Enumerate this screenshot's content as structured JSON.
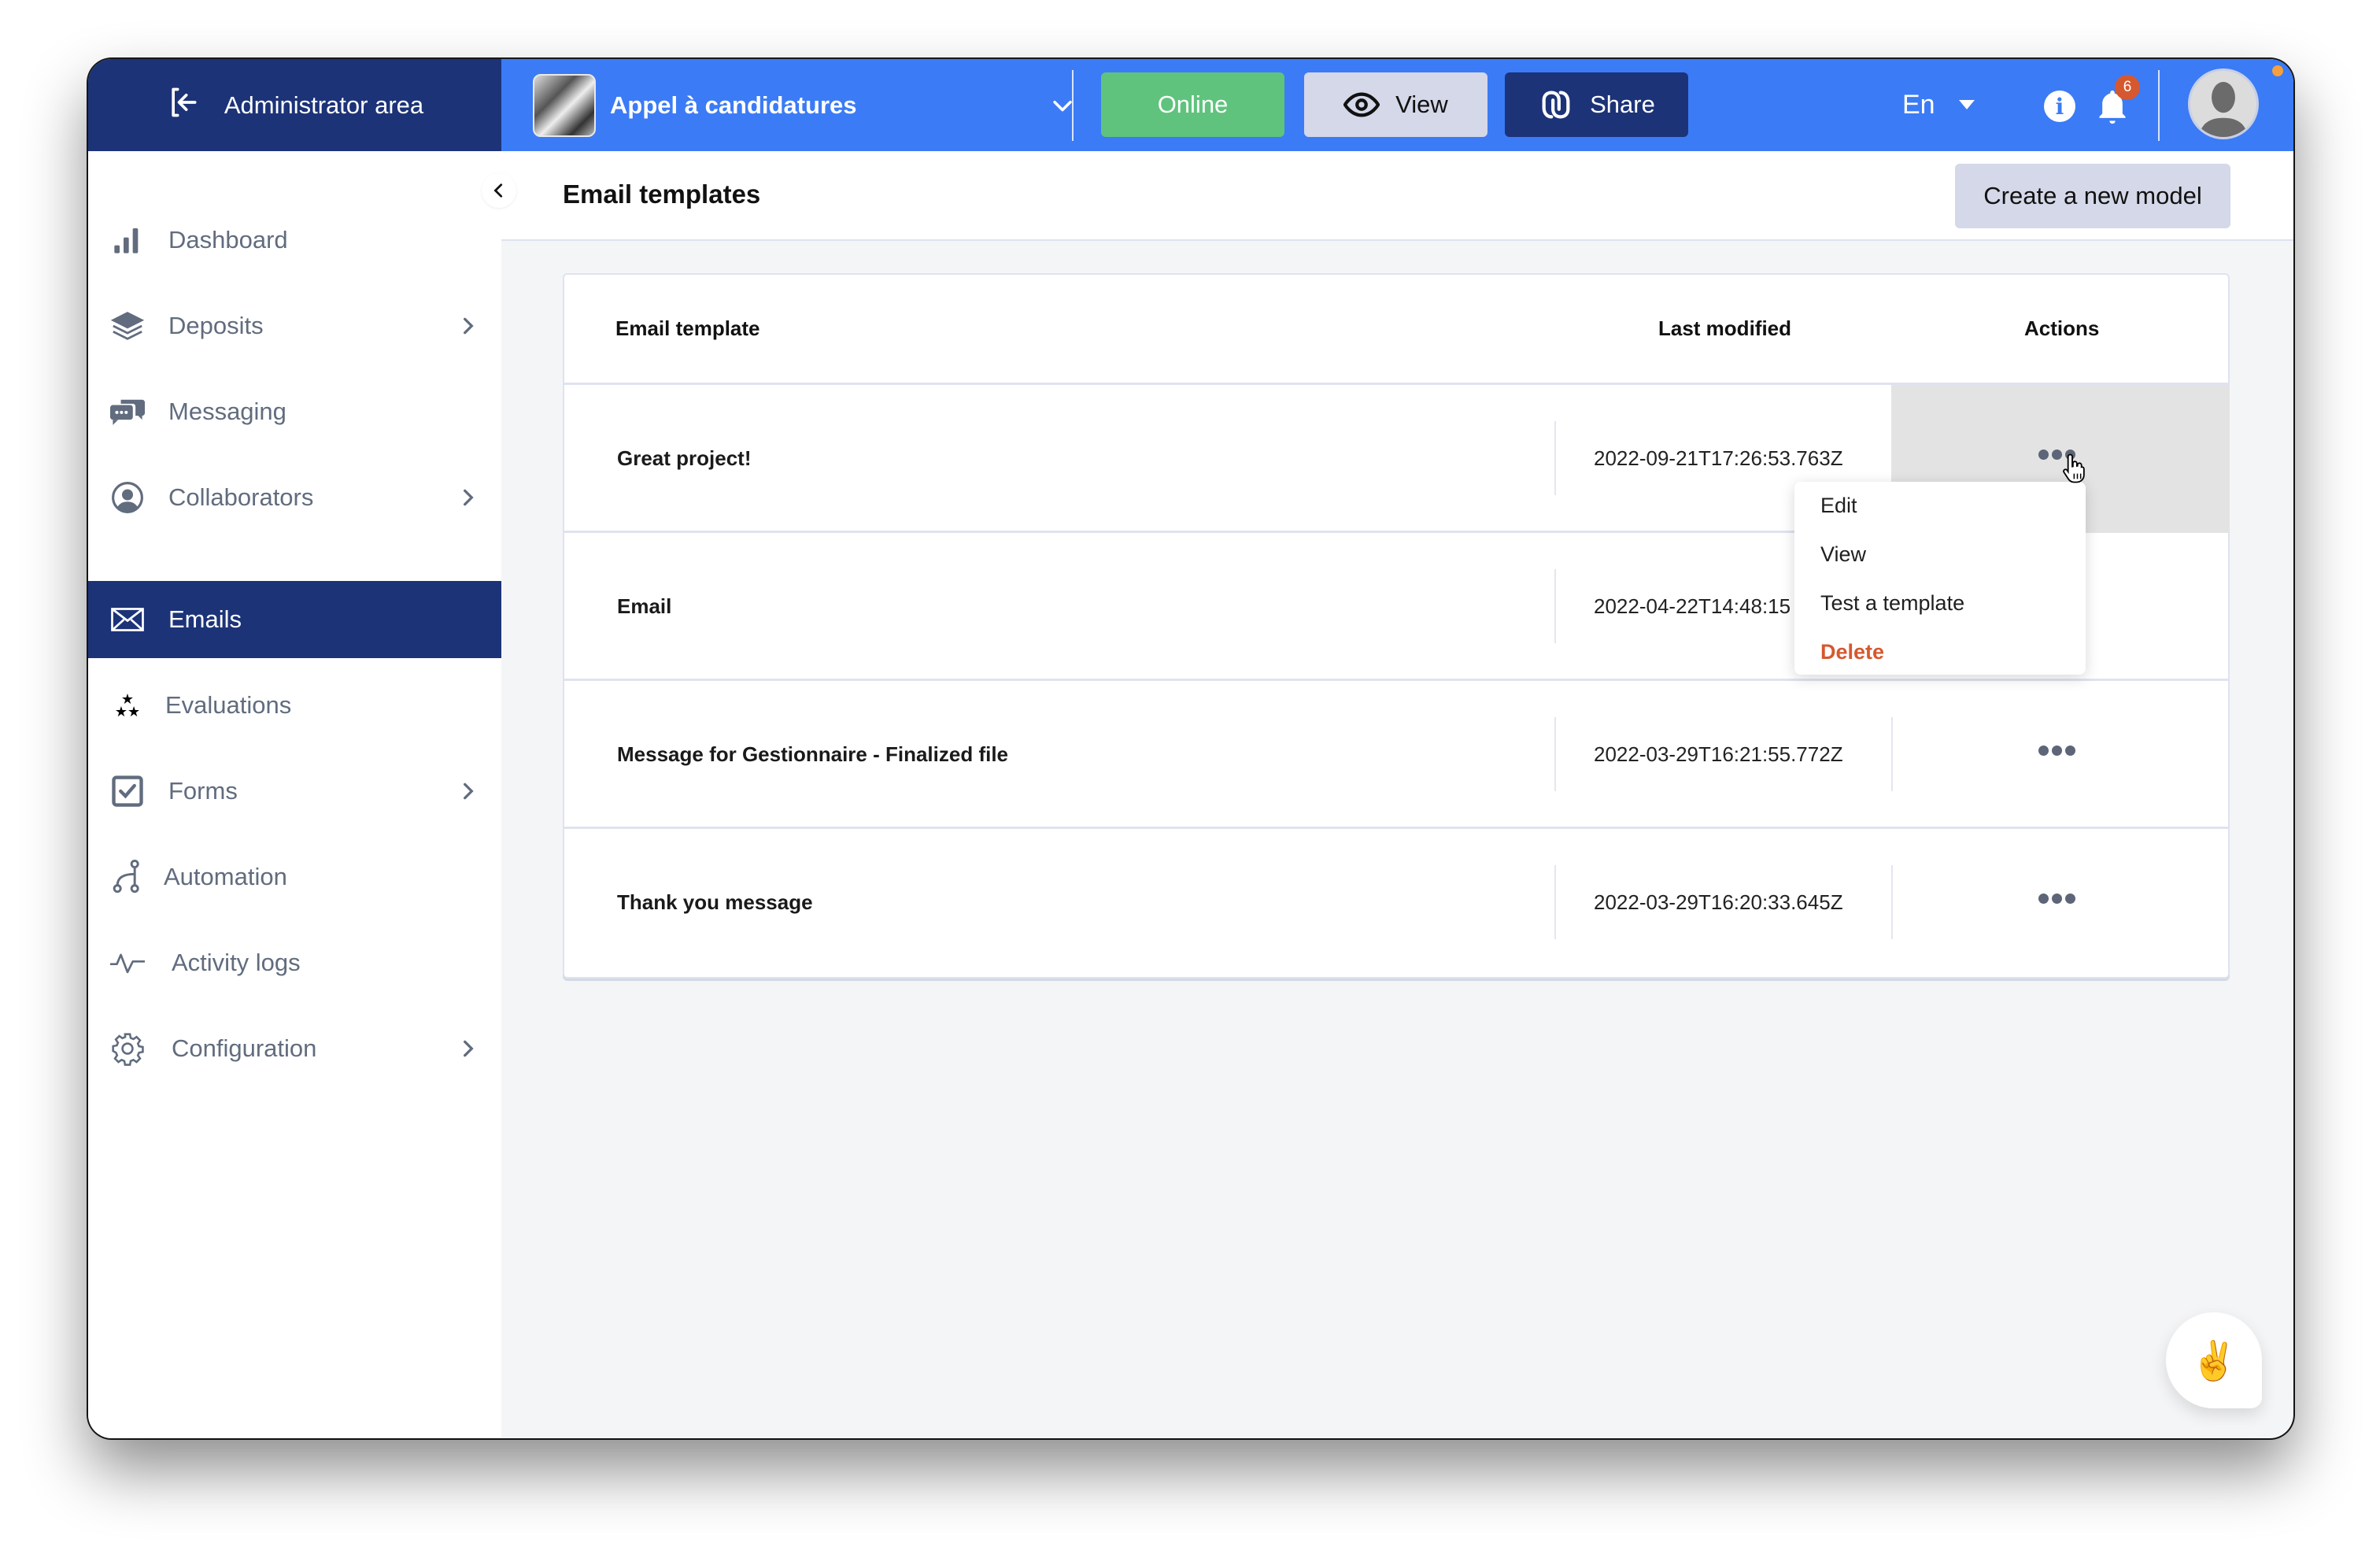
{
  "topbar": {
    "admin_area_label": "Administrator area",
    "project_name": "Appel à candidatures",
    "status_button": "Online",
    "view_button": "View",
    "share_button": "Share",
    "language": "En",
    "notifications_count": "6",
    "colors": {
      "bar": "#3b7bf5",
      "admin": "#1c3378",
      "online": "#5fc37d",
      "badge": "#d6582f"
    }
  },
  "sidebar": {
    "items": [
      {
        "label": "Dashboard",
        "icon": "bar-chart-icon",
        "has_submenu": false
      },
      {
        "label": "Deposits",
        "icon": "layers-icon",
        "has_submenu": true
      },
      {
        "label": "Messaging",
        "icon": "chat-bubbles-icon",
        "has_submenu": false
      },
      {
        "label": "Collaborators",
        "icon": "user-circle-icon",
        "has_submenu": true
      },
      {
        "label": "Emails",
        "icon": "envelope-icon",
        "has_submenu": false,
        "active": true
      },
      {
        "label": "Evaluations",
        "icon": "stars-icon",
        "has_submenu": false
      },
      {
        "label": "Forms",
        "icon": "checkbox-icon",
        "has_submenu": true
      },
      {
        "label": "Automation",
        "icon": "branch-icon",
        "has_submenu": false
      },
      {
        "label": "Activity logs",
        "icon": "pulse-icon",
        "has_submenu": false
      },
      {
        "label": "Configuration",
        "icon": "gear-icon",
        "has_submenu": true
      }
    ]
  },
  "page": {
    "title": "Email templates",
    "create_button": "Create a new model"
  },
  "table": {
    "columns": [
      "Email template",
      "Last modified",
      "Actions"
    ],
    "rows": [
      {
        "name": "Great project!",
        "last_modified": "2022-09-21T17:26:53.763Z"
      },
      {
        "name": "Email",
        "last_modified": "2022-04-22T14:48:15"
      },
      {
        "name": "Message for Gestionnaire - Finalized file",
        "last_modified": "2022-03-29T16:21:55.772Z"
      },
      {
        "name": "Thank you message",
        "last_modified": "2022-03-29T16:20:33.645Z"
      }
    ]
  },
  "actions_menu": {
    "items": [
      "Edit",
      "View",
      "Test a template",
      "Delete"
    ]
  },
  "help_bubble": {
    "emoji": "✌️"
  }
}
